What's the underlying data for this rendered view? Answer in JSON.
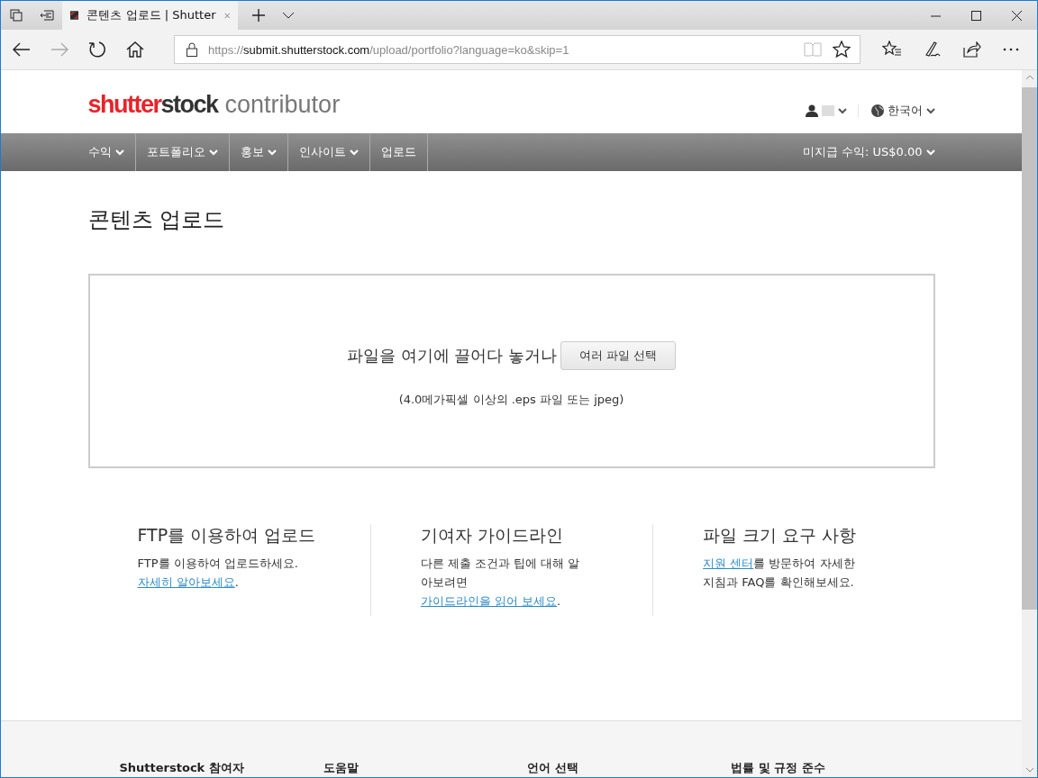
{
  "browser": {
    "tab_title": "콘텐츠 업로드 | Shutter",
    "url_host_prefix": "https://",
    "url_host": "submit.shutterstock.com",
    "url_path": "/upload/portfolio?language=ko&skip=1"
  },
  "header": {
    "logo_part_1": "shutter",
    "logo_part_2": "stock",
    "product": "contributor",
    "language": "한국어"
  },
  "nav": {
    "items": [
      {
        "label": "수익",
        "dropdown": true
      },
      {
        "label": "포트폴리오",
        "dropdown": true
      },
      {
        "label": "홍보",
        "dropdown": true
      },
      {
        "label": "인사이트",
        "dropdown": true
      },
      {
        "label": "업로드",
        "dropdown": false
      }
    ],
    "earnings": "미지급 수익: US$0.00"
  },
  "page_title": "콘텐츠 업로드",
  "dropzone": {
    "prompt": "파일을 여기에 끌어다 놓거나",
    "button": "여러 파일 선택",
    "hint": "(4.0메가픽셀 이상의 .eps 파일 또는 jpeg)"
  },
  "info": [
    {
      "title": "FTP를 이용하여 업로드",
      "before": "FTP를 이용하여 업로드하세요. ",
      "link": "자세히 알아보세요",
      "after": "."
    },
    {
      "title": "기여자 가이드라인",
      "before": "다른 제출 조건과 팁에 대해 알아보려면 ",
      "link": "가이드라인을 읽어 보세요",
      "after": "."
    },
    {
      "title": "파일 크기 요구 사항",
      "link": "지원 센터",
      "after": "를 방문하여 자세한 지침과 FAQ를 확인해보세요."
    }
  ],
  "footer": [
    "Shutterstock 참여자",
    "도움말",
    "언어 선택",
    "법률 및 규정 준수"
  ]
}
